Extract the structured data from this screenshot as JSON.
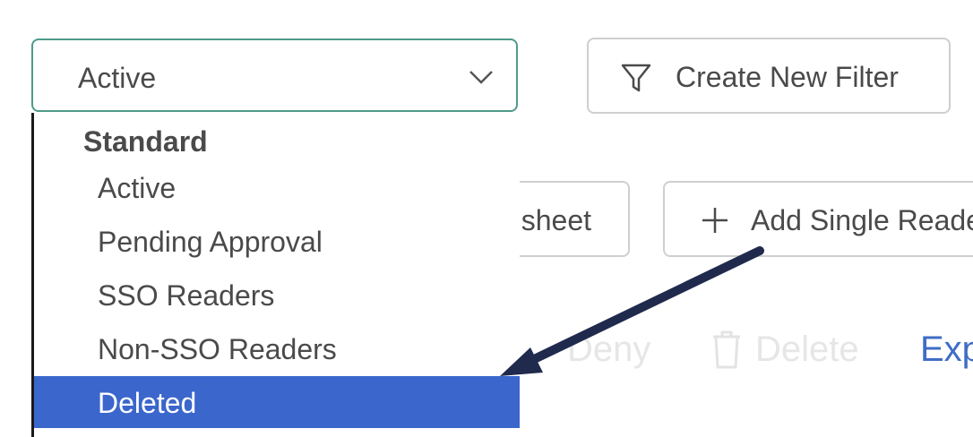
{
  "filter_select": {
    "value": "Active",
    "chevron_icon": "chevron-down-icon"
  },
  "create_filter": {
    "label": "Create New Filter",
    "icon": "funnel-icon"
  },
  "spreadsheet_button": {
    "label": "sheet"
  },
  "add_reader_button": {
    "label": "Add Single Reader",
    "icon": "plus-icon"
  },
  "actions": {
    "deny": "Deny",
    "delete": "Delete",
    "export": "Exp",
    "delete_icon": "trash-icon"
  },
  "dropdown": {
    "group_label": "Standard",
    "options": [
      "Active",
      "Pending Approval",
      "SSO Readers",
      "Non-SSO Readers",
      "Deleted"
    ],
    "selected": "Deleted"
  },
  "colors": {
    "select_border": "#4f9a8a",
    "highlight": "#3b66cc",
    "link": "#3e6dc5",
    "annotation_arrow": "#1f2a4d"
  }
}
